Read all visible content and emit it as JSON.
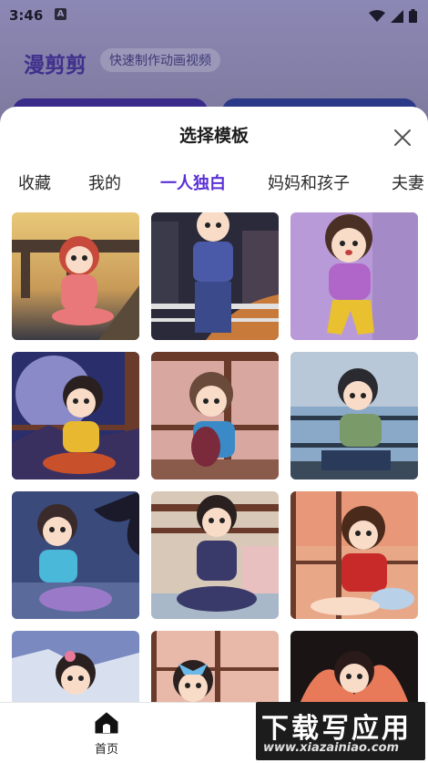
{
  "status_bar": {
    "time": "3:46",
    "badge": "A"
  },
  "background": {
    "app_title": "漫剪剪",
    "subtitle": "快速制作动画视频"
  },
  "sheet": {
    "title": "选择模板",
    "tabs": [
      {
        "label": "收藏",
        "active": false
      },
      {
        "label": "我的",
        "active": false
      },
      {
        "label": "一人独白",
        "active": true
      },
      {
        "label": "妈妈和孩子",
        "active": false
      },
      {
        "label": "夫妻",
        "active": false
      }
    ],
    "templates": [
      {
        "scene": "bridge-sunset-girl-red-hair"
      },
      {
        "scene": "city-night-boy-blue"
      },
      {
        "scene": "purple-girl-yellow-pants"
      },
      {
        "scene": "moon-girl-yellow-shirt"
      },
      {
        "scene": "window-boy-sad-hug"
      },
      {
        "scene": "lake-girl-green-shirt"
      },
      {
        "scene": "night-tree-girl-cyan"
      },
      {
        "scene": "window-girl-purple"
      },
      {
        "scene": "sunset-girl-red-dress"
      },
      {
        "scene": "snow-girl-flower"
      },
      {
        "scene": "window-girl-bow"
      },
      {
        "scene": "flower-girl-dark"
      }
    ]
  },
  "bottom_nav": {
    "home_label": "首页"
  },
  "watermark": {
    "text": "下载写应用",
    "url": "www.xiazainiao.com"
  },
  "colors": {
    "accent": "#5a2fd6",
    "brand": "#3f2f8c"
  }
}
